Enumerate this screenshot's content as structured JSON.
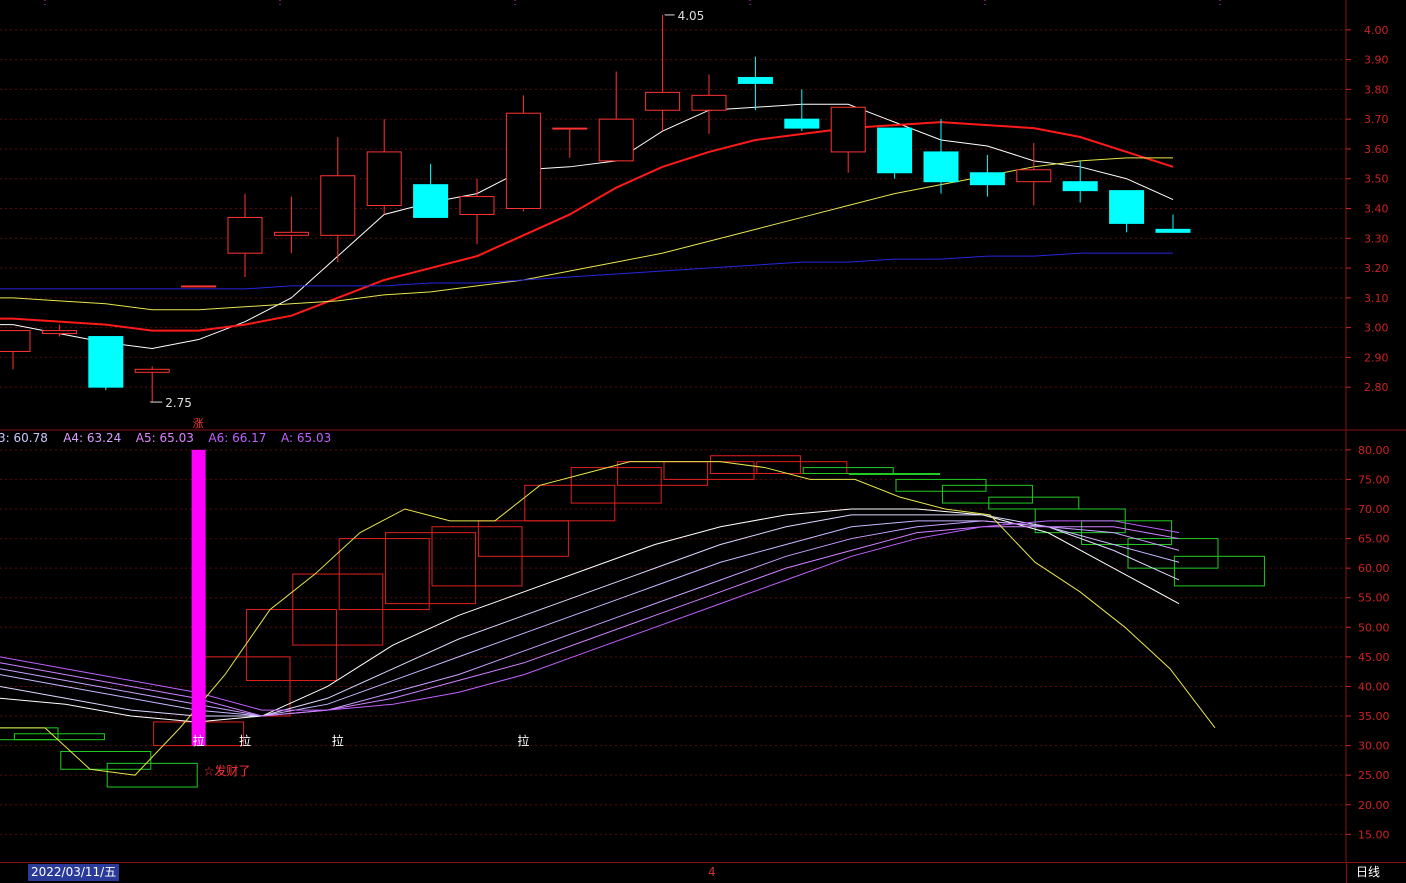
{
  "chart_data": [
    {
      "type": "candlestick",
      "ylim": [
        2.72,
        4.08
      ],
      "y_ticks": [
        "4.00",
        "3.90",
        "3.80",
        "3.70",
        "3.60",
        "3.50",
        "3.40",
        "3.30",
        "3.20",
        "3.10",
        "3.00",
        "2.90",
        "2.80"
      ],
      "annotations": {
        "high_label": "4.05",
        "low_label": "2.75"
      },
      "candles": [
        {
          "o": 2.92,
          "h": 2.98,
          "l": 2.86,
          "c": 2.99
        },
        {
          "o": 2.98,
          "h": 3.01,
          "l": 2.97,
          "c": 2.99
        },
        {
          "o": 2.97,
          "h": 2.97,
          "l": 2.79,
          "c": 2.8
        },
        {
          "o": 2.85,
          "h": 2.87,
          "l": 2.75,
          "c": 2.86
        },
        {
          "o": 3.14,
          "h": 3.14,
          "l": 3.14,
          "c": 3.14
        },
        {
          "o": 3.25,
          "h": 3.45,
          "l": 3.17,
          "c": 3.37
        },
        {
          "o": 3.31,
          "h": 3.44,
          "l": 3.25,
          "c": 3.32
        },
        {
          "o": 3.31,
          "h": 3.64,
          "l": 3.22,
          "c": 3.51
        },
        {
          "o": 3.41,
          "h": 3.7,
          "l": 3.38,
          "c": 3.59
        },
        {
          "o": 3.48,
          "h": 3.55,
          "l": 3.37,
          "c": 3.37
        },
        {
          "o": 3.38,
          "h": 3.5,
          "l": 3.28,
          "c": 3.44
        },
        {
          "o": 3.4,
          "h": 3.78,
          "l": 3.39,
          "c": 3.72
        },
        {
          "o": 3.67,
          "h": 3.67,
          "l": 3.57,
          "c": 3.67
        },
        {
          "o": 3.56,
          "h": 3.86,
          "l": 3.56,
          "c": 3.7
        },
        {
          "o": 3.73,
          "h": 4.05,
          "l": 3.66,
          "c": 3.79
        },
        {
          "o": 3.73,
          "h": 3.85,
          "l": 3.65,
          "c": 3.78
        },
        {
          "o": 3.84,
          "h": 3.91,
          "l": 3.73,
          "c": 3.82
        },
        {
          "o": 3.7,
          "h": 3.8,
          "l": 3.66,
          "c": 3.67
        },
        {
          "o": 3.59,
          "h": 3.74,
          "l": 3.52,
          "c": 3.74
        },
        {
          "o": 3.67,
          "h": 3.67,
          "l": 3.5,
          "c": 3.52
        },
        {
          "o": 3.59,
          "h": 3.7,
          "l": 3.45,
          "c": 3.49
        },
        {
          "o": 3.52,
          "h": 3.58,
          "l": 3.44,
          "c": 3.48
        },
        {
          "o": 3.49,
          "h": 3.62,
          "l": 3.41,
          "c": 3.53
        },
        {
          "o": 3.49,
          "h": 3.56,
          "l": 3.42,
          "c": 3.46
        },
        {
          "o": 3.46,
          "h": 3.46,
          "l": 3.32,
          "c": 3.35
        },
        {
          "o": 3.33,
          "h": 3.38,
          "l": 3.32,
          "c": 3.32
        }
      ],
      "ma_lines": [
        {
          "color": "#ffffff",
          "values": [
            3.01,
            2.98,
            2.95,
            2.93,
            2.96,
            3.02,
            3.1,
            3.24,
            3.38,
            3.42,
            3.45,
            3.53,
            3.54,
            3.56,
            3.66,
            3.73,
            3.74,
            3.75,
            3.75,
            3.69,
            3.63,
            3.61,
            3.56,
            3.54,
            3.5,
            3.43
          ]
        },
        {
          "color": "#ff1a1a",
          "values": [
            3.03,
            3.02,
            3.01,
            2.99,
            2.99,
            3.01,
            3.04,
            3.1,
            3.16,
            3.2,
            3.24,
            3.31,
            3.38,
            3.47,
            3.54,
            3.59,
            3.63,
            3.65,
            3.67,
            3.68,
            3.69,
            3.68,
            3.67,
            3.64,
            3.59,
            3.54
          ]
        },
        {
          "color": "#e6e64d",
          "values": [
            3.1,
            3.09,
            3.08,
            3.06,
            3.06,
            3.07,
            3.08,
            3.09,
            3.11,
            3.12,
            3.14,
            3.16,
            3.19,
            3.22,
            3.25,
            3.29,
            3.33,
            3.37,
            3.41,
            3.45,
            3.48,
            3.51,
            3.54,
            3.56,
            3.57,
            3.57
          ]
        },
        {
          "color": "#2626e0",
          "values": [
            3.13,
            3.13,
            3.13,
            3.13,
            3.13,
            3.13,
            3.14,
            3.14,
            3.14,
            3.15,
            3.15,
            3.16,
            3.17,
            3.18,
            3.19,
            3.2,
            3.21,
            3.22,
            3.22,
            3.23,
            3.23,
            3.24,
            3.24,
            3.25,
            3.25,
            3.25
          ]
        }
      ]
    },
    {
      "type": "indicator",
      "ylim": [
        11,
        82
      ],
      "y_ticks": [
        "80.00",
        "75.00",
        "70.00",
        "65.00",
        "60.00",
        "55.00",
        "50.00",
        "45.00",
        "40.00",
        "35.00",
        "30.00",
        "25.00",
        "20.00",
        "15.00"
      ],
      "legend": [
        {
          "text": "3: 60.78",
          "color": "#c8c8ff"
        },
        {
          "text": "A4: 63.24",
          "color": "#d8a0ff"
        },
        {
          "text": "A5: 65.03",
          "color": "#e080ff"
        },
        {
          "text": "A6: 66.17",
          "color": "#c060ff"
        },
        {
          "text": "A: 65.03",
          "color": "#c060ff"
        }
      ],
      "yellow_line": [
        33,
        33,
        26,
        25,
        33,
        42,
        53,
        59,
        66,
        70,
        68,
        68,
        74,
        76,
        78,
        78,
        78,
        77,
        75,
        75,
        72,
        70,
        69,
        61,
        56,
        50,
        43,
        33
      ],
      "box_series": [
        {
          "lo": 31,
          "hi": 33,
          "col": "g"
        },
        {
          "lo": 31,
          "hi": 32,
          "col": "g"
        },
        {
          "lo": 26,
          "hi": 29,
          "col": "g"
        },
        {
          "lo": 23,
          "hi": 27,
          "col": "g"
        },
        {
          "lo": 30,
          "hi": 34,
          "col": "r"
        },
        {
          "lo": 35,
          "hi": 45,
          "col": "r"
        },
        {
          "lo": 41,
          "hi": 53,
          "col": "r"
        },
        {
          "lo": 47,
          "hi": 59,
          "col": "r"
        },
        {
          "lo": 53,
          "hi": 65,
          "col": "r"
        },
        {
          "lo": 54,
          "hi": 66,
          "col": "r"
        },
        {
          "lo": 57,
          "hi": 67,
          "col": "r"
        },
        {
          "lo": 62,
          "hi": 68,
          "col": "r"
        },
        {
          "lo": 68,
          "hi": 74,
          "col": "r"
        },
        {
          "lo": 71,
          "hi": 77,
          "col": "r"
        },
        {
          "lo": 74,
          "hi": 78,
          "col": "r"
        },
        {
          "lo": 75,
          "hi": 78,
          "col": "r"
        },
        {
          "lo": 76,
          "hi": 79,
          "col": "r"
        },
        {
          "lo": 76,
          "hi": 78,
          "col": "r"
        },
        {
          "lo": 76,
          "hi": 77,
          "col": "g"
        },
        {
          "lo": 76,
          "hi": 76,
          "col": "g"
        },
        {
          "lo": 73,
          "hi": 75,
          "col": "g"
        },
        {
          "lo": 71,
          "hi": 74,
          "col": "g"
        },
        {
          "lo": 70,
          "hi": 72,
          "col": "g"
        },
        {
          "lo": 66,
          "hi": 70,
          "col": "g"
        },
        {
          "lo": 64,
          "hi": 68,
          "col": "g"
        },
        {
          "lo": 60,
          "hi": 65,
          "col": "g"
        },
        {
          "lo": 57,
          "hi": 62,
          "col": "g"
        }
      ],
      "fan_lines": [
        {
          "color": "#ffffff",
          "values": [
            38,
            37,
            35,
            34,
            35,
            40,
            47,
            52,
            56,
            60,
            64,
            67,
            69,
            70,
            70,
            69,
            66,
            60,
            54
          ]
        },
        {
          "color": "#ddd8ff",
          "values": [
            40,
            38,
            36,
            35,
            35,
            38,
            43,
            48,
            52,
            56,
            60,
            64,
            67,
            69,
            69,
            69,
            67,
            63,
            58
          ]
        },
        {
          "color": "#c8b8ff",
          "values": [
            42,
            40,
            38,
            36,
            35,
            37,
            41,
            45,
            49,
            53,
            57,
            61,
            64,
            67,
            68,
            68,
            67,
            64,
            61
          ]
        },
        {
          "color": "#c8a0ff",
          "values": [
            43,
            41,
            39,
            37,
            35,
            36,
            39,
            42,
            46,
            50,
            54,
            58,
            62,
            65,
            67,
            68,
            67,
            66,
            63
          ]
        },
        {
          "color": "#d080ff",
          "values": [
            44,
            42,
            40,
            38,
            35,
            36,
            38,
            41,
            44,
            48,
            52,
            56,
            60,
            63,
            66,
            67,
            67,
            67,
            65
          ]
        },
        {
          "color": "#c060ff",
          "values": [
            45,
            43,
            41,
            39,
            36,
            36,
            37,
            39,
            42,
            46,
            50,
            54,
            58,
            62,
            65,
            67,
            68,
            68,
            66
          ]
        }
      ],
      "signal_bar": {
        "index": 4,
        "lo": 30,
        "hi": 80
      },
      "markers": [
        {
          "text": "拉",
          "index": 4
        },
        {
          "text": "拉",
          "index": 5
        },
        {
          "text": "拉",
          "index": 7
        },
        {
          "text": "拉",
          "index": 11
        }
      ],
      "up_label": "涨",
      "signal_text": "☆发财了"
    }
  ],
  "statusbar": {
    "date_label": "2022/03/11/五",
    "mid_marker": "4",
    "period_label": "日线"
  }
}
